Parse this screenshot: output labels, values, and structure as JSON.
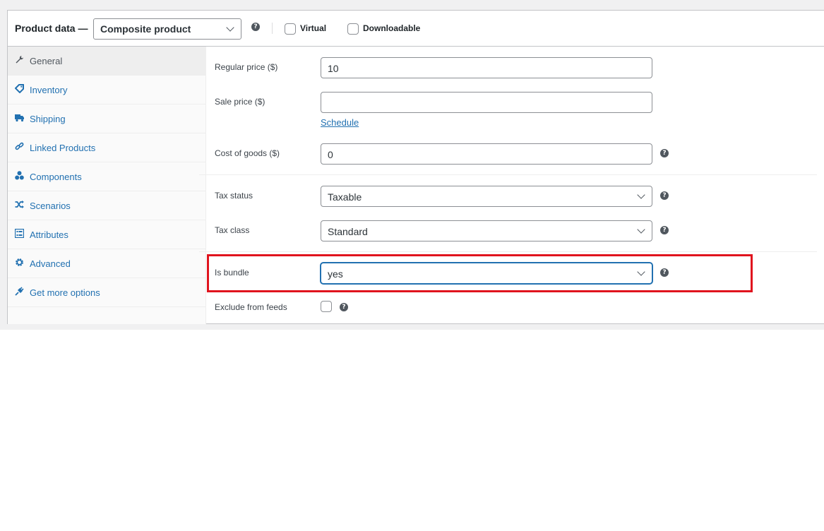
{
  "header": {
    "title": "Product data —",
    "product_type": "Composite product",
    "virtual_label": "Virtual",
    "downloadable_label": "Downloadable"
  },
  "sidebar": {
    "items": [
      {
        "label": "General",
        "icon": "wrench-icon"
      },
      {
        "label": "Inventory",
        "icon": "tag-icon"
      },
      {
        "label": "Shipping",
        "icon": "truck-icon"
      },
      {
        "label": "Linked Products",
        "icon": "link-icon"
      },
      {
        "label": "Components",
        "icon": "components-icon"
      },
      {
        "label": "Scenarios",
        "icon": "shuffle-icon"
      },
      {
        "label": "Attributes",
        "icon": "list-icon"
      },
      {
        "label": "Advanced",
        "icon": "gear-icon"
      },
      {
        "label": "Get more options",
        "icon": "plugin-icon"
      }
    ]
  },
  "fields": {
    "regular_price": {
      "label": "Regular price ($)",
      "value": "10"
    },
    "sale_price": {
      "label": "Sale price ($)",
      "value": "",
      "schedule_link": "Schedule"
    },
    "cost_of_goods": {
      "label": "Cost of goods ($)",
      "value": "0"
    },
    "tax_status": {
      "label": "Tax status",
      "value": "Taxable"
    },
    "tax_class": {
      "label": "Tax class",
      "value": "Standard"
    },
    "is_bundle": {
      "label": "Is bundle",
      "value": "yes"
    },
    "exclude_from_feeds": {
      "label": "Exclude from feeds"
    }
  },
  "help_glyph": "?",
  "colors": {
    "accent": "#2271b1",
    "highlight": "#e0141e"
  }
}
